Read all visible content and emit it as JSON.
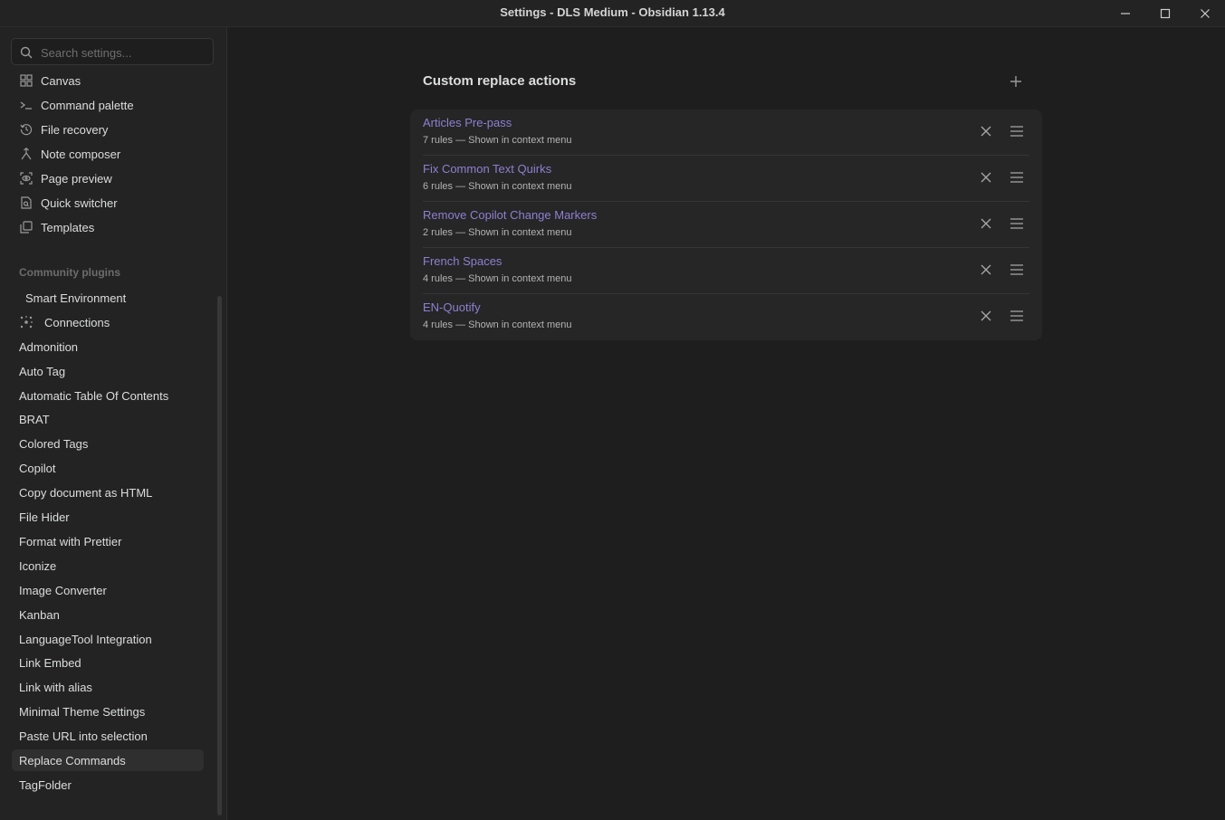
{
  "window": {
    "title": "Settings - DLS Medium - Obsidian 1.13.4",
    "controls": [
      "minimize-icon",
      "maximize-icon",
      "close-icon"
    ]
  },
  "sidebar": {
    "search_placeholder": "Search settings...",
    "core_items": [
      {
        "label": "Canvas",
        "icon": "grid-icon"
      },
      {
        "label": "Command palette",
        "icon": "terminal-icon"
      },
      {
        "label": "File recovery",
        "icon": "history-icon"
      },
      {
        "label": "Note composer",
        "icon": "merge-icon"
      },
      {
        "label": "Page preview",
        "icon": "preview-icon"
      },
      {
        "label": "Quick switcher",
        "icon": "file-search-icon"
      },
      {
        "label": "Templates",
        "icon": "copy-icon"
      }
    ],
    "community_header": "Community plugins",
    "community_items": [
      {
        "label": "Smart Environment",
        "icon": ""
      },
      {
        "label": "Connections",
        "icon": "network-icon"
      },
      {
        "label": "Admonition"
      },
      {
        "label": "Auto Tag"
      },
      {
        "label": "Automatic Table Of Contents"
      },
      {
        "label": "BRAT"
      },
      {
        "label": "Colored Tags"
      },
      {
        "label": "Copilot"
      },
      {
        "label": "Copy document as HTML"
      },
      {
        "label": "File Hider"
      },
      {
        "label": "Format with Prettier"
      },
      {
        "label": "Iconize"
      },
      {
        "label": "Image Converter"
      },
      {
        "label": "Kanban"
      },
      {
        "label": "LanguageTool Integration"
      },
      {
        "label": "Link Embed"
      },
      {
        "label": "Link with alias"
      },
      {
        "label": "Minimal Theme Settings"
      },
      {
        "label": "Paste URL into selection"
      },
      {
        "label": "Replace Commands",
        "active": true
      },
      {
        "label": "TagFolder"
      }
    ]
  },
  "main": {
    "heading": "Custom replace actions",
    "add_icon": "plus-icon",
    "actions": [
      {
        "name": "Articles Pre-pass",
        "desc": "7 rules — Shown in context menu"
      },
      {
        "name": "Fix Common Text Quirks",
        "desc": "6 rules — Shown in context menu"
      },
      {
        "name": "Remove Copilot Change Markers",
        "desc": "2 rules — Shown in context menu"
      },
      {
        "name": "French Spaces",
        "desc": "4 rules — Shown in context menu"
      },
      {
        "name": "EN-Quotify",
        "desc": "4 rules — Shown in context menu"
      }
    ]
  },
  "colors": {
    "background": "#1e1e1e",
    "sidebar": "#232323",
    "accent": "#8f7fd2",
    "text": "#dcddde"
  }
}
